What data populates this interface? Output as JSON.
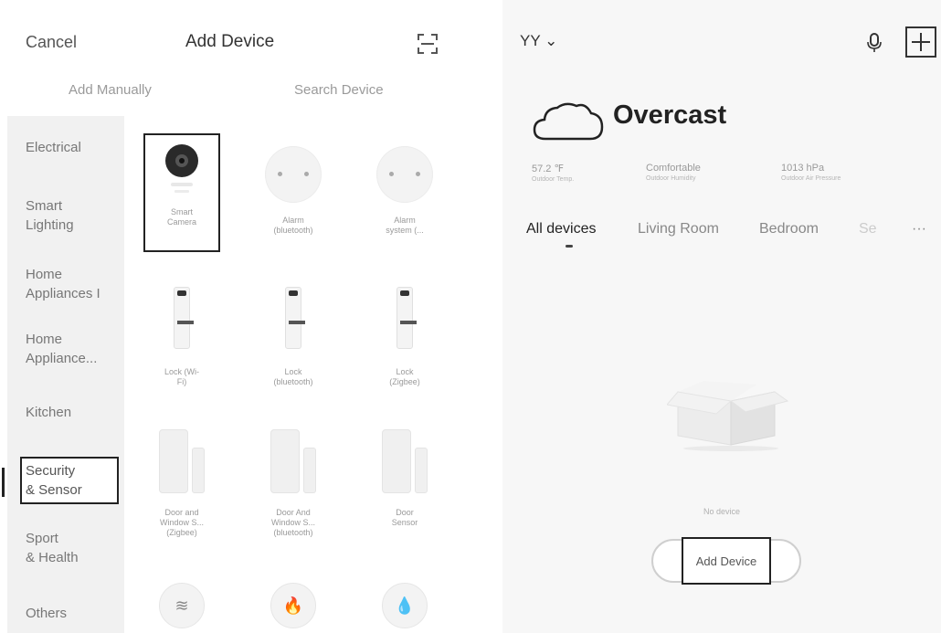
{
  "left": {
    "header": {
      "cancel": "Cancel",
      "title": "Add Device"
    },
    "tabs": {
      "manual": "Add Manually",
      "search": "Search Device"
    },
    "categories": [
      "Electrical",
      "Smart\nLighting",
      "Home\nAppliances I",
      "Home\nAppliance...",
      "Kitchen",
      "Security\n& Sensor",
      "Sport\n& Health",
      "Others"
    ],
    "selected_category": "Security\n& Sensor",
    "devices": [
      {
        "label": "Smart\nCamera",
        "icon": "camera-icon"
      },
      {
        "label": "Alarm\n(bluetooth)",
        "icon": "alarm-icon"
      },
      {
        "label": "Alarm\nsystem  (...",
        "icon": "alarm-icon"
      },
      {
        "label": "Lock  (Wi-\nFi)",
        "icon": "lock-icon"
      },
      {
        "label": "Lock\n(bluetooth)",
        "icon": "lock-icon"
      },
      {
        "label": "Lock\n(Zigbee)",
        "icon": "lock-icon"
      },
      {
        "label": "Door and\nWindow S...\n(Zigbee)",
        "icon": "door-sensor-icon"
      },
      {
        "label": "Door And\nWindow S...\n(bluetooth)",
        "icon": "door-sensor-icon"
      },
      {
        "label": "Door\nSensor",
        "icon": "door-sensor-icon"
      }
    ],
    "bottom_icons": [
      "≋",
      "🔥",
      "💧"
    ]
  },
  "right": {
    "home": "YY ⌄",
    "weather": {
      "title": "Overcast",
      "stats": [
        {
          "value": "57.2 ℉",
          "label": "Outdoor Temp."
        },
        {
          "value": "Comfortable",
          "label": "Outdoor Humidity"
        },
        {
          "value": "1013 hPa",
          "label": "Outdoor Air Pressure"
        }
      ]
    },
    "rooms": [
      "All devices",
      "Living Room",
      "Bedroom",
      "Se",
      "···"
    ],
    "empty_text": "No device",
    "add_button": "Add Device"
  },
  "colors": {
    "selection_border": "#222222",
    "sidebar_bg": "#f1f1f1",
    "right_bg": "#f7f7f7"
  }
}
